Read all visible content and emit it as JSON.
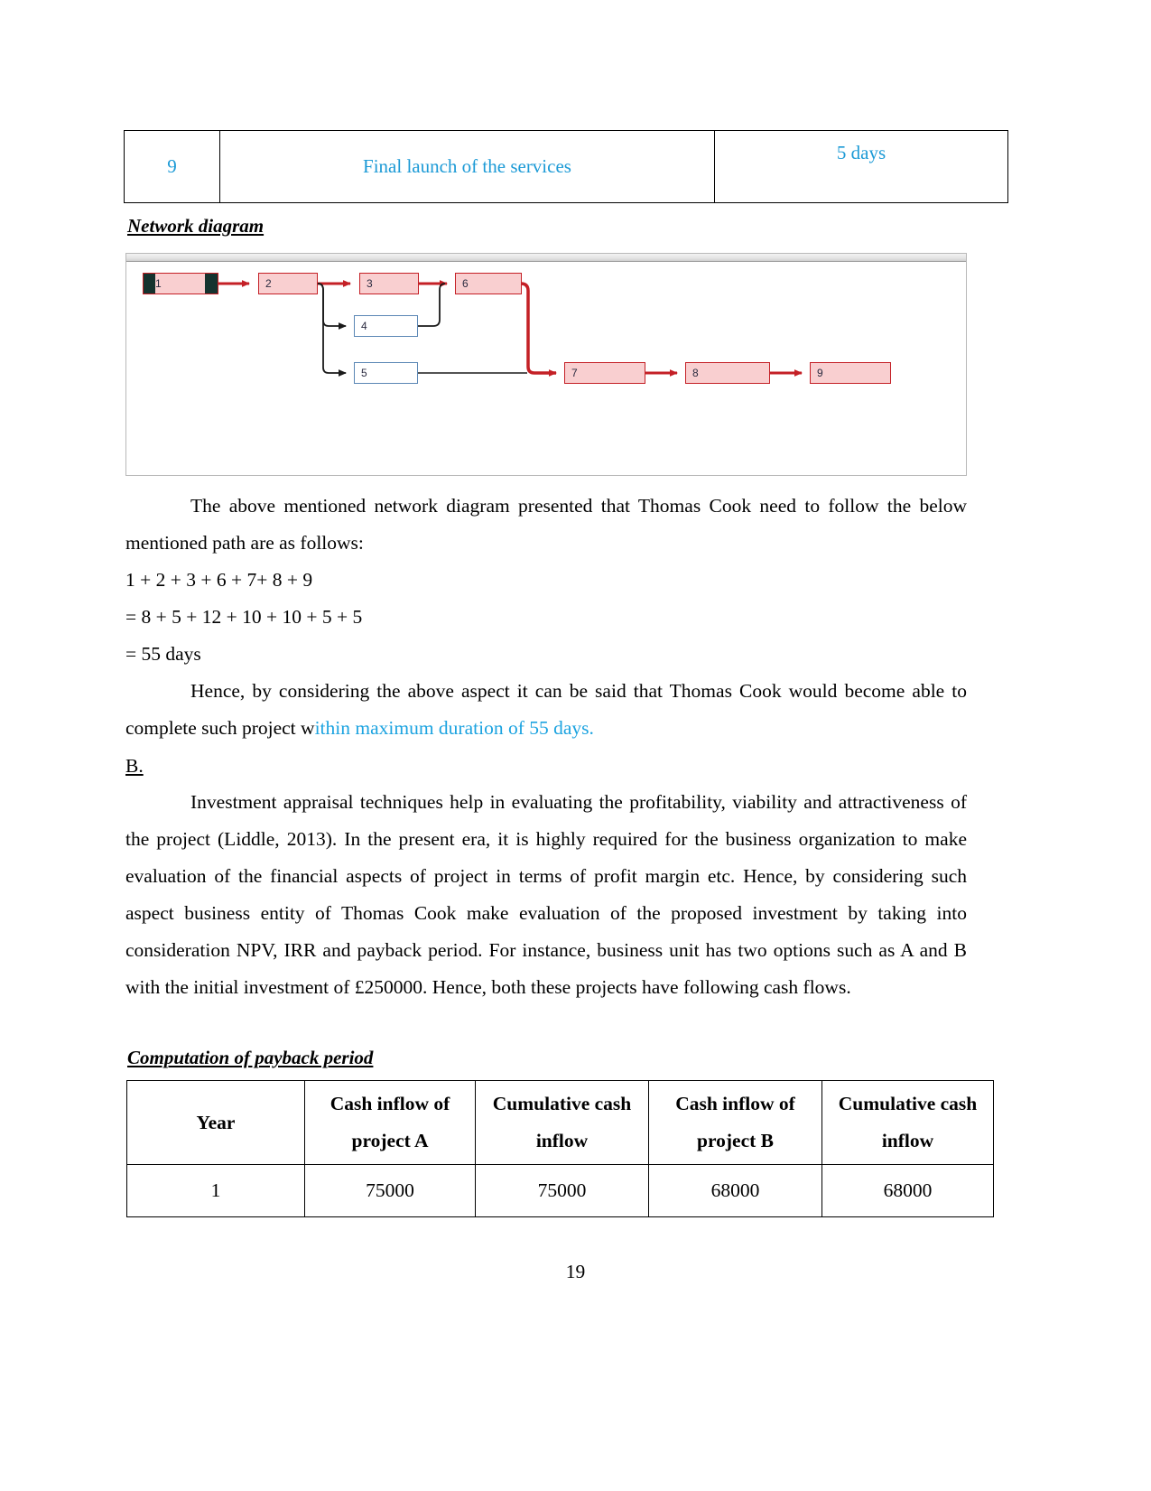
{
  "top_table": {
    "row": {
      "number": "9",
      "activity": "Final launch of the services",
      "duration": "5 days"
    },
    "text_color": "#1C9AD6"
  },
  "headings": {
    "network_diagram": "Network diagram",
    "computation_payback": "Computation of payback period"
  },
  "diagram": {
    "nodes": [
      {
        "id": "1",
        "label": "1",
        "kind": "critical-start"
      },
      {
        "id": "2",
        "label": "2",
        "kind": "critical"
      },
      {
        "id": "3",
        "label": "3",
        "kind": "critical"
      },
      {
        "id": "6",
        "label": "6",
        "kind": "critical"
      },
      {
        "id": "4",
        "label": "4",
        "kind": "normal"
      },
      {
        "id": "5",
        "label": "5",
        "kind": "normal"
      },
      {
        "id": "7",
        "label": "7",
        "kind": "critical"
      },
      {
        "id": "8",
        "label": "8",
        "kind": "critical"
      },
      {
        "id": "9",
        "label": "9",
        "kind": "critical"
      }
    ],
    "critical_color": "#C42026",
    "critical_fill": "#F9CFD0",
    "normal_border": "#5B87B5",
    "links": [
      {
        "from": "1",
        "to": "2",
        "critical": true
      },
      {
        "from": "2",
        "to": "3",
        "critical": true
      },
      {
        "from": "2",
        "to": "4",
        "critical": false
      },
      {
        "from": "2",
        "to": "5",
        "critical": false
      },
      {
        "from": "3",
        "to": "6",
        "critical": true
      },
      {
        "from": "4",
        "to": "6",
        "critical": false
      },
      {
        "from": "5",
        "to": "7",
        "critical": false
      },
      {
        "from": "6",
        "to": "7",
        "critical": true
      },
      {
        "from": "7",
        "to": "8",
        "critical": true
      },
      {
        "from": "8",
        "to": "9",
        "critical": true
      }
    ]
  },
  "body": {
    "p_above_1": "The above mentioned network diagram presented that Thomas Cook need to follow the",
    "p_above_2": "below mentioned path are as follows:",
    "path_line_1": "1 + 2 + 3 + 6 + 7+ 8 + 9",
    "path_line_2": "= 8 + 5 + 12 + 10 + 10 + 5 + 5",
    "path_line_3": "= 55 days",
    "p_hence_1": "Hence, by considering the above aspect it can be said that Thomas Cook would become",
    "p_hence_2_black": "able to complete such project w",
    "p_hence_2_cyan": "ithin maximum duration of 55 days.",
    "section_b": "B.",
    "p_invest": "Investment appraisal techniques help in evaluating the profitability, viability and attractiveness of the project (Liddle, 2013). In the present era, it is highly required for the business organization to make evaluation of the financial aspects of project in terms of profit margin etc. Hence, by considering such aspect business entity of Thomas Cook make evaluation of the proposed investment by taking into consideration NPV, IRR and payback period. For instance, business unit has two options such as A and B with the initial investment of £250000. Hence, both these projects have following cash flows."
  },
  "payback_table": {
    "headers": [
      "Year",
      "Cash inflow of project A",
      "Cumulative cash inflow",
      "Cash inflow of project B",
      "Cumulative cash inflow"
    ],
    "headers_split": [
      {
        "l1": "",
        "l2": "Year"
      },
      {
        "l1": "Cash inflow of",
        "l2": "project A"
      },
      {
        "l1": "Cumulative cash",
        "l2": "inflow"
      },
      {
        "l1": "Cash inflow of",
        "l2": "project B"
      },
      {
        "l1": "Cumulative cash",
        "l2": "inflow"
      }
    ],
    "rows": [
      {
        "year": "1",
        "inflow_a": "75000",
        "cum_a": "75000",
        "inflow_b": "68000",
        "cum_b": "68000"
      }
    ]
  },
  "footer": {
    "page_number": "19"
  }
}
